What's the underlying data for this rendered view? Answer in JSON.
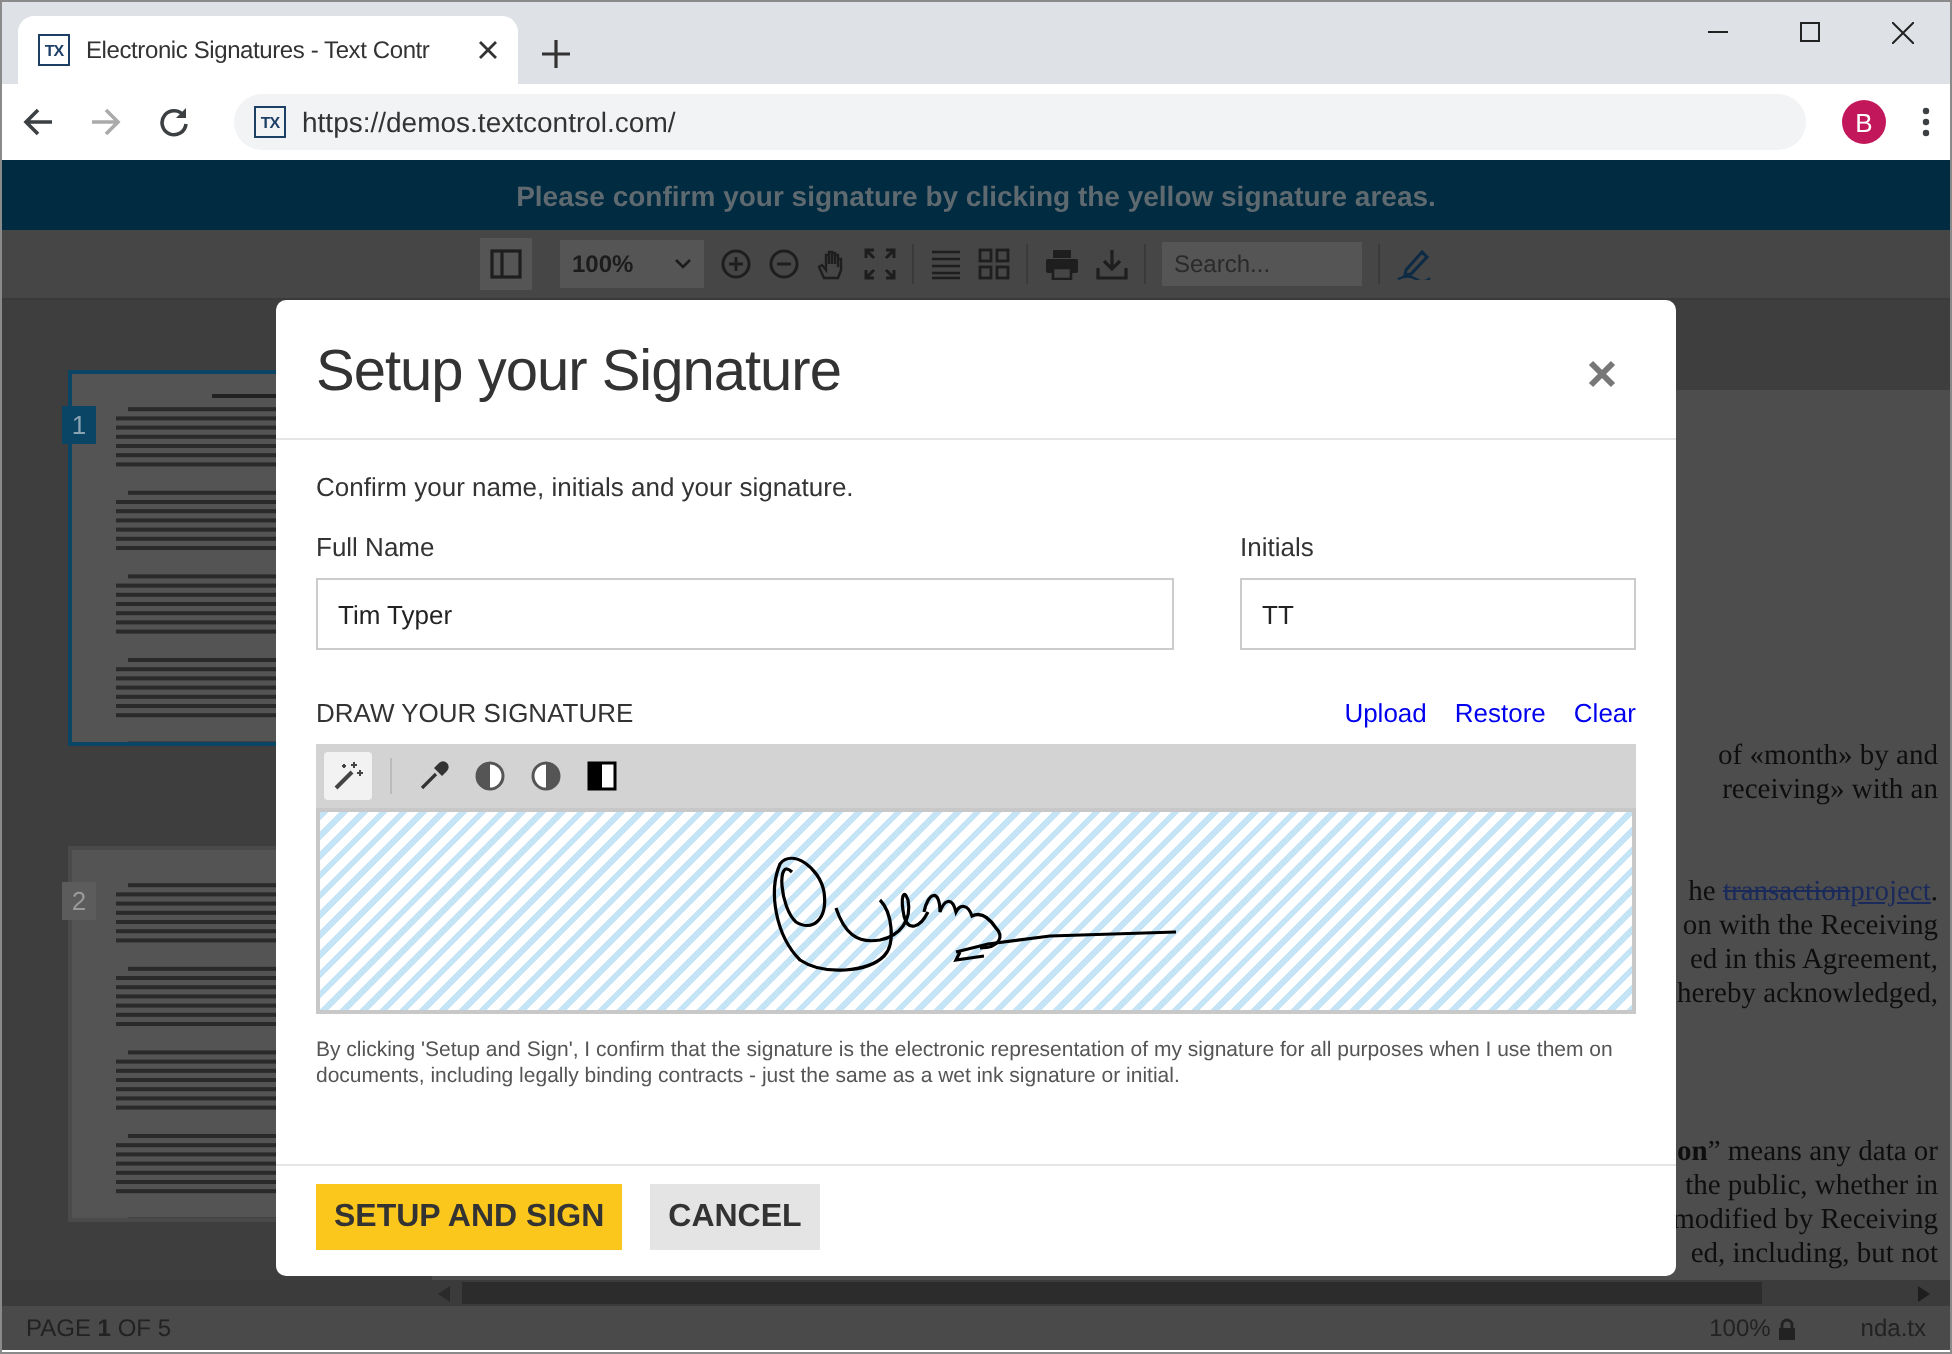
{
  "browser": {
    "tab": {
      "favicon": "TX",
      "title": "Electronic Signatures - Text Contr"
    },
    "address": {
      "favicon": "TX",
      "url": "https://demos.textcontrol.com/",
      "forward_disabled": true
    },
    "profile": "B"
  },
  "banner": "Please confirm your signature by clicking the yellow signature areas.",
  "toolbar": {
    "zoom": "100%",
    "search": {
      "placeholder": "Search..."
    }
  },
  "thumbnails": [
    {
      "number": "1",
      "selected": true
    },
    {
      "number": "2",
      "selected": false
    }
  ],
  "document": {
    "paragraphs": [
      [
        [
          {
            "text": "of «month» by and",
            "kind": "plain"
          }
        ],
        [
          {
            "text": "receiving» with an",
            "kind": "plain"
          }
        ]
      ],
      [
        [
          {
            "text": "he ",
            "kind": "plain"
          },
          {
            "text": "transaction",
            "kind": "deleted"
          },
          {
            "text": "project",
            "kind": "inserted"
          },
          {
            "text": ".",
            "kind": "plain"
          }
        ],
        [
          {
            "text": "on with the Receiving",
            "kind": "plain"
          }
        ],
        [
          {
            "text": "ed in this Agreement,",
            "kind": "plain"
          }
        ],
        [
          {
            "text": "hereby acknowledged,",
            "kind": "plain"
          }
        ]
      ],
      [
        [
          {
            "text": "on",
            "kind": "bold"
          },
          {
            "text": "” means any data or",
            "kind": "plain"
          }
        ],
        [
          {
            "text": "the public, whether in",
            "kind": "plain"
          }
        ],
        [
          {
            "text": "modified by Receiving",
            "kind": "plain"
          }
        ],
        [
          {
            "text": "ed, including, but not",
            "kind": "plain"
          }
        ]
      ]
    ]
  },
  "status_bar": {
    "page": "PAGE **1** OF 5",
    "zoom": "100%",
    "file": "nda.tx"
  },
  "dialog": {
    "title": "Setup your Signature",
    "intro": "Confirm your name, initials and your signature.",
    "fields": [
      {
        "label": "Full Name",
        "value": "Tim Typer"
      },
      {
        "label": "Initials",
        "value": "TT"
      }
    ],
    "signature": {
      "heading": "DRAW YOUR SIGNATURE",
      "links": [
        "Upload",
        "Restore",
        "Clear"
      ],
      "tools": [
        {
          "kind": "wand",
          "selected": true
        },
        {
          "kind": "eyedropper",
          "selected": false
        },
        {
          "kind": "contrast-left",
          "selected": false
        },
        {
          "kind": "contrast-right",
          "selected": false
        },
        {
          "kind": "invert",
          "selected": false
        }
      ]
    },
    "disclaimer": "By clicking 'Setup and Sign', I confirm that the signature is the electronic representation of my signature for all purposes when I use them on documents, including legally binding contracts - just the same as a wet ink signature or initial.",
    "buttons": [
      {
        "label": "SETUP AND SIGN",
        "kind": "primary"
      },
      {
        "label": "CANCEL",
        "kind": "secondary"
      }
    ]
  }
}
